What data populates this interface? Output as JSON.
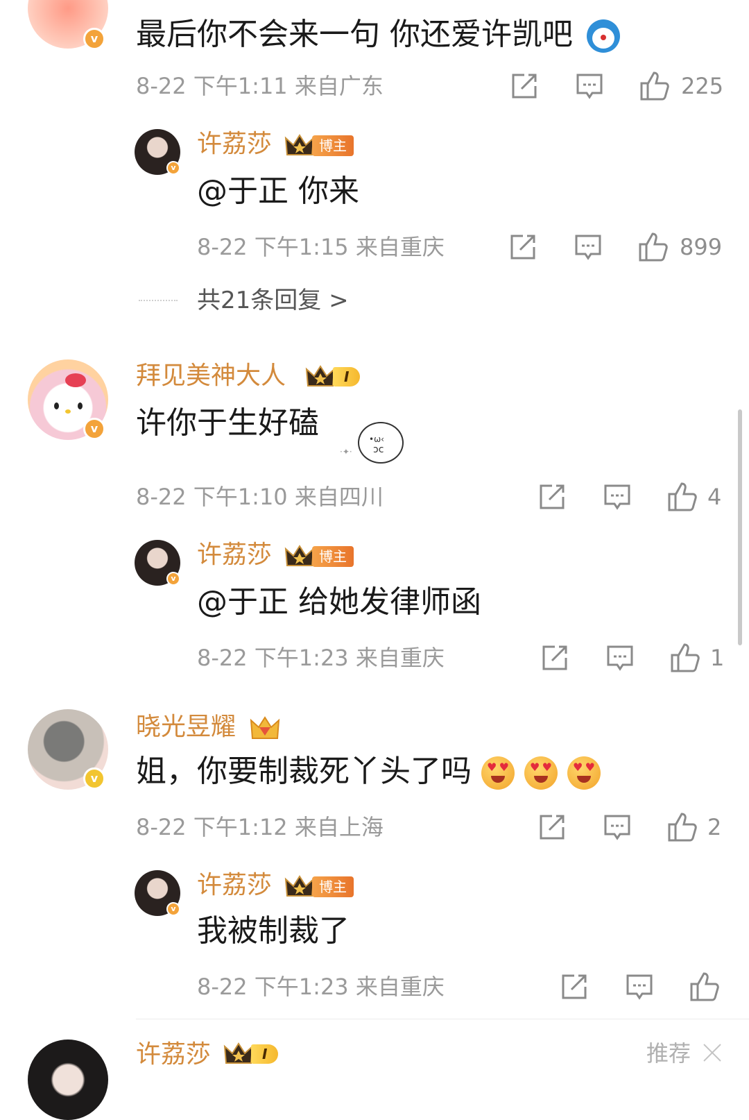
{
  "comments": [
    {
      "text": "最后你不会来一句 你还爱许凯吧",
      "emoji": "doraemon-emoji",
      "date": "8-22",
      "time": "下午1:11",
      "location": "来自广东",
      "likes": "225",
      "reply": {
        "name": "许荔莎",
        "badge": "博主",
        "text": "@于正 你来",
        "date": "8-22",
        "time": "下午1:15",
        "location": "来自重庆",
        "likes": "899"
      },
      "more_replies": "共21条回复 >"
    },
    {
      "name": "拜见美神大人",
      "level": "I",
      "text": "许你于生好磕",
      "date": "8-22",
      "time": "下午1:10",
      "location": "来自四川",
      "likes": "4",
      "reply": {
        "name": "许荔莎",
        "badge": "博主",
        "text": "@于正 给她发律师函",
        "date": "8-22",
        "time": "下午1:23",
        "location": "来自重庆",
        "likes": "1"
      }
    },
    {
      "name": "晓光昱耀",
      "text": "姐，你要制裁死丫头了吗",
      "date": "8-22",
      "time": "下午1:12",
      "location": "来自上海",
      "likes": "2",
      "reply": {
        "name": "许荔莎",
        "badge": "博主",
        "text": "我被制裁了",
        "date": "8-22",
        "time": "下午1:23",
        "location": "来自重庆",
        "likes": ""
      }
    },
    {
      "name": "许荔莎",
      "level": "I",
      "tag": "推荐"
    }
  ],
  "colors": {
    "username": "#d38a3c",
    "meta": "#9a9a9a",
    "verified": "#f3a33a"
  }
}
